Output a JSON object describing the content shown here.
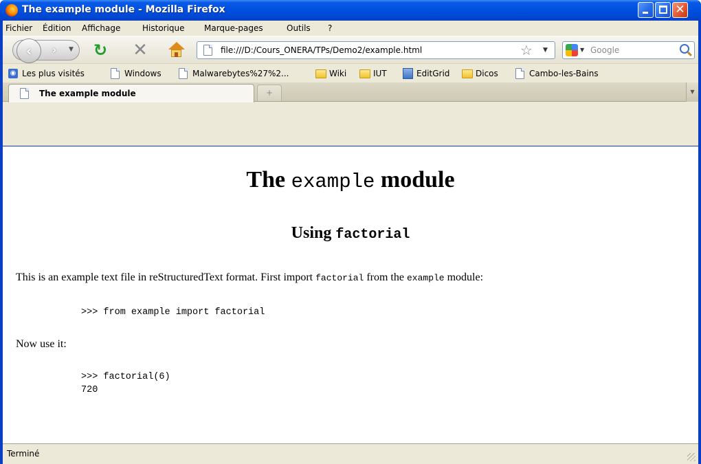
{
  "window": {
    "title": "The example module - Mozilla Firefox",
    "controls": {
      "minimize": "minimize",
      "maximize": "maximize",
      "close": "✕"
    }
  },
  "menubar": {
    "items": [
      "Fichier",
      "Édition",
      "Affichage",
      "Historique",
      "Marque-pages",
      "Outils",
      "?"
    ]
  },
  "navbar": {
    "url": "file:///D:/Cours_ONERA/TPs/Demo2/example.html",
    "search_placeholder": "Google"
  },
  "bookmarks": {
    "items": [
      {
        "label": "Les plus visités",
        "icon": "most-visited-icon"
      },
      {
        "label": "Windows",
        "icon": "page-icon"
      },
      {
        "label": "Malwarebytes%27%2...",
        "icon": "page-icon"
      },
      {
        "label": "Wiki",
        "icon": "folder-icon"
      },
      {
        "label": "IUT",
        "icon": "folder-icon"
      },
      {
        "label": "EditGrid",
        "icon": "editgrid-icon"
      },
      {
        "label": "Dicos",
        "icon": "folder-icon"
      },
      {
        "label": "Cambo-les-Bains",
        "icon": "page-icon"
      }
    ]
  },
  "tabs": {
    "active_label": "The example module",
    "new_tab_glyph": "+"
  },
  "page": {
    "h1_prefix": "The",
    "h1_code": "example",
    "h1_suffix": "module",
    "h2_prefix": "Using",
    "h2_code": "factorial",
    "para1_a": "This is an example text file in reStructuredText format. First import",
    "para1_code1": "factorial",
    "para1_b": "from the",
    "para1_code2": "example",
    "para1_c": "module:",
    "code1": ">>> from example import factorial",
    "para2": "Now use it:",
    "code2_line1": ">>> factorial(6)",
    "code2_line2": "720"
  },
  "status": {
    "text": "Terminé"
  },
  "colors": {
    "titlebar": "#0050e0",
    "chrome": "#ece9d8",
    "reload_green": "#1f9e2c"
  }
}
